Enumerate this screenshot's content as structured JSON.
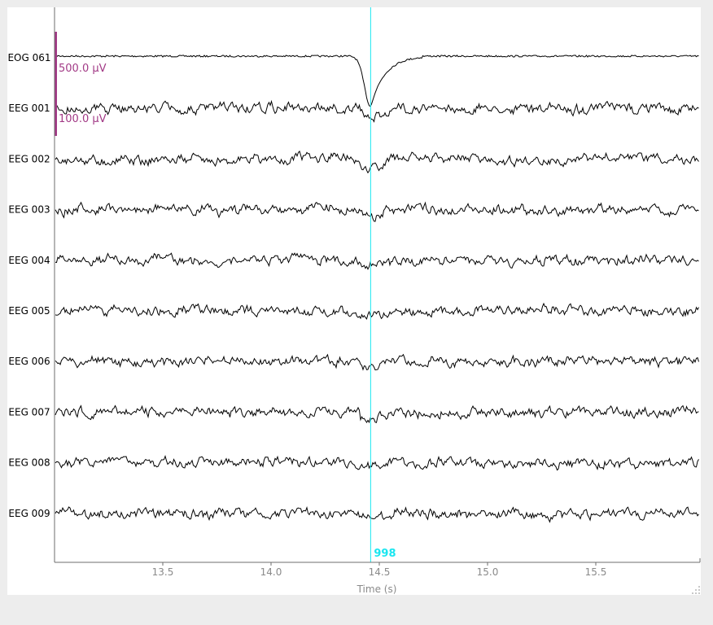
{
  "chart_data": {
    "type": "line",
    "xlabel": "Time (s)",
    "xlim": [
      13.0,
      16.0
    ],
    "xticks": [
      "13.5",
      "14.0",
      "14.5",
      "15.0",
      "15.5"
    ],
    "channels": [
      "EOG 061",
      "EEG 001",
      "EEG 002",
      "EEG 003",
      "EEG 004",
      "EEG 005",
      "EEG 006",
      "EEG 007",
      "EEG 008",
      "EEG 009"
    ],
    "scale_bars": [
      {
        "label": "500.0 µV",
        "channel": "EOG 061"
      },
      {
        "label": "100.0 µV",
        "channel": "EEG 001"
      }
    ],
    "event": {
      "time": 14.46,
      "label": "998",
      "color": "#19e6f0"
    },
    "trace_color": "#000000",
    "scale_bar_color": "#a23a86"
  }
}
